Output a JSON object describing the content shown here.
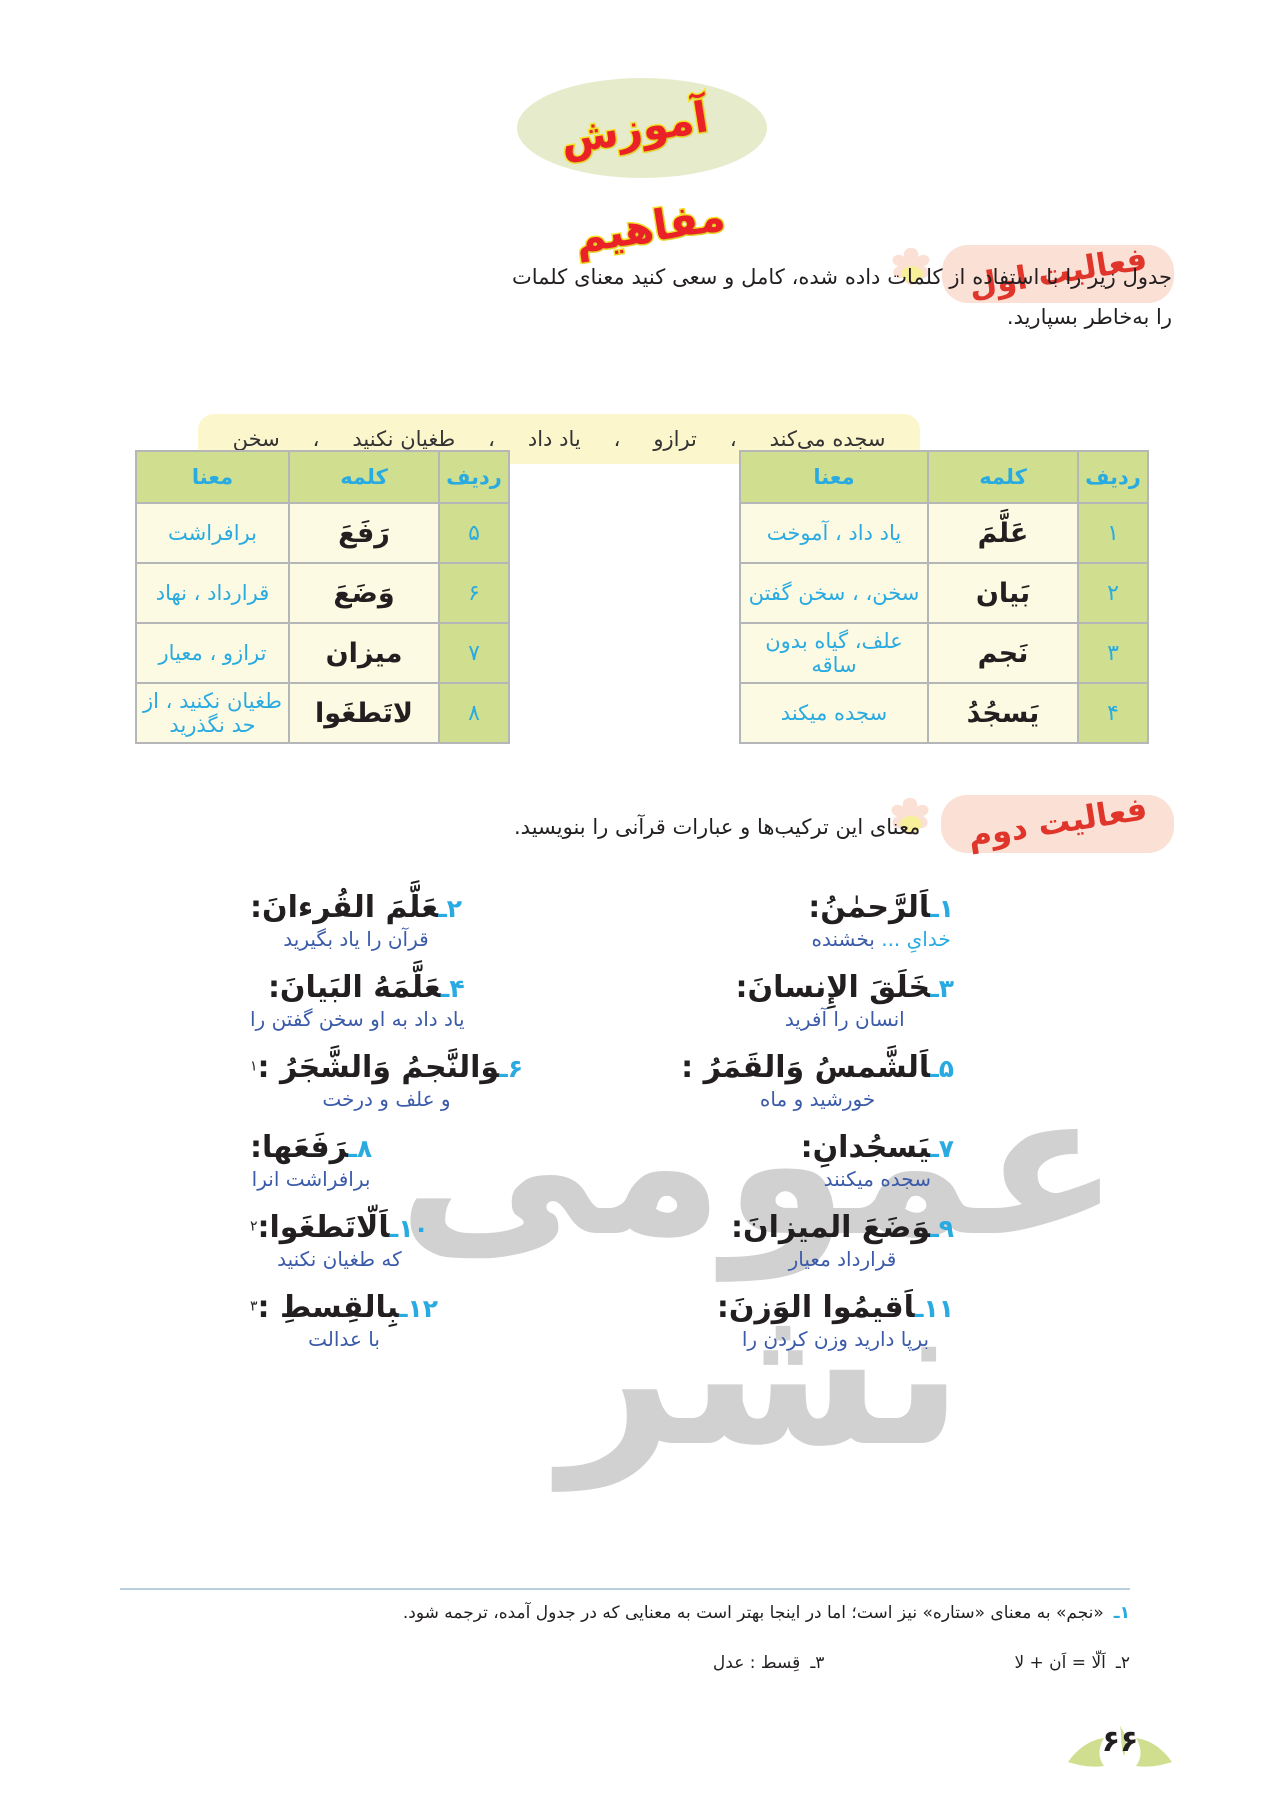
{
  "page": {
    "title": "آموزش مفاهیم",
    "number": "۶۶"
  },
  "activity_one": {
    "badge": "فعالیت اول",
    "instruction": "جدول زیر را با استفاده از کلمات داده شده، کامل و سعی کنید معنای کلمات را به‌خاطر بسپارید.",
    "word_bank": [
      "سجده می‌کند",
      "ترازو",
      "یاد داد",
      "طغیان نکنید",
      "سخن"
    ],
    "table_headers": {
      "index": "ردیف",
      "word": "کلمه",
      "meaning": "معنا"
    },
    "table_right": [
      {
        "index": "۱",
        "word": "عَلَّمَ",
        "meaning": "یاد  داد  ، آموخت"
      },
      {
        "index": "۲",
        "word": "بَیان",
        "meaning": "سخن،  ، سخن گفتن"
      },
      {
        "index": "۳",
        "word": "نَجم",
        "meaning": "علف، گیاه بدون ساقه"
      },
      {
        "index": "۴",
        "word": "یَسجُدُ",
        "meaning": "سجده  میکند"
      }
    ],
    "table_left": [
      {
        "index": "۵",
        "word": "رَفَعَ",
        "meaning": "برافراشت"
      },
      {
        "index": "۶",
        "word": "وَضَعَ",
        "meaning": "قرارداد ، نهاد"
      },
      {
        "index": "۷",
        "word": "میزان",
        "meaning": "ترازو  ، معیار"
      },
      {
        "index": "۸",
        "word": "لاتَطغَوا",
        "meaning": "طغیان نکنید ، از حد نگذرید"
      }
    ]
  },
  "activity_two": {
    "badge": "فعالیت دوم",
    "instruction": "معنای این ترکیب‌ها و عبارات قرآنی را بنویسید.",
    "items": [
      {
        "num": "۱ـ",
        "arabic": "اَلرَّحمٰنُ:",
        "gloss": "خدایِ ... بخشنده",
        "hl": "خدایِ ...",
        "col": "right"
      },
      {
        "num": "۲ـ",
        "arabic": "عَلَّمَ القُرءانَ:",
        "gloss": "قرآن  را  یاد  بگیرید",
        "hl": "",
        "col": "left"
      },
      {
        "num": "۳ـ",
        "arabic": "خَلَقَ الإِنسانَ:",
        "gloss": "انسان  را  آفرید",
        "hl": "",
        "col": "right"
      },
      {
        "num": "۴ـ",
        "arabic": "عَلَّمَهُ البَیانَ:",
        "gloss": "یاد داد به او سخن گفتن  را",
        "hl": "",
        "col": "left"
      },
      {
        "num": "۵ـ",
        "arabic": "اَلشَّمسُ وَالقَمَرُ :",
        "gloss": "خورشید  و  ماه",
        "hl": "",
        "col": "right"
      },
      {
        "num": "۶ـ",
        "arabic": "وَالنَّجمُ وَالشَّجَرُ :",
        "gloss": "و علف  و  درخت",
        "hl": "",
        "col": "left",
        "sup": "۱"
      },
      {
        "num": "۷ـ",
        "arabic": "یَسجُدانِ:",
        "gloss": "سجده  میکنند",
        "hl": "",
        "col": "right"
      },
      {
        "num": "۸ـ",
        "arabic": "رَفَعَها:",
        "gloss": "برافراشت  انرا",
        "hl": "",
        "col": "left"
      },
      {
        "num": "۹ـ",
        "arabic": "وَضَعَ المیزانَ:",
        "gloss": "قرارداد  معیار",
        "hl": "",
        "col": "right"
      },
      {
        "num": "۱۰ـ",
        "arabic": "اَلّاتَطغَوا:",
        "gloss": "که  طغیان  نکنید",
        "hl": "",
        "col": "left",
        "sup": "۲"
      },
      {
        "num": "۱۱ـ",
        "arabic": "اَقیمُوا الوَزنَ:",
        "gloss": "برپا  دارید  وزن کردن  را",
        "hl": "",
        "col": "right"
      },
      {
        "num": "۱۲ـ",
        "arabic": "بِالقِسطِ :",
        "gloss": "با  عدالت",
        "hl": "",
        "col": "left",
        "sup": "۳"
      }
    ]
  },
  "footnotes": [
    {
      "num": "۱ـ",
      "text": "«نجم» به معنای «ستاره» نیز است؛ اما در اینجا بهتر است به معنایی که  در جدول آمده، ترجمه شود."
    },
    {
      "num": "۲ـ",
      "text": "اَلّا = اَن + لا"
    },
    {
      "num": "۳ـ",
      "text": "قِسط : عدل"
    }
  ],
  "colors": {
    "title_red": "#ea2127",
    "title_yellow_stroke": "#f5e32a",
    "title_ellipse": "#e6eccb",
    "badge_pink": "#fbe0d5",
    "badge_red": "#e0352b",
    "table_header_green": "#cfdf8f",
    "table_body_cream": "#fdfae3",
    "wordbank_yellow": "#fcf6cd",
    "accent_blue": "#29abe2",
    "gloss_blue": "#3b5ba9",
    "text_black": "#231f20",
    "watermark_gray": "#c9cacb"
  }
}
